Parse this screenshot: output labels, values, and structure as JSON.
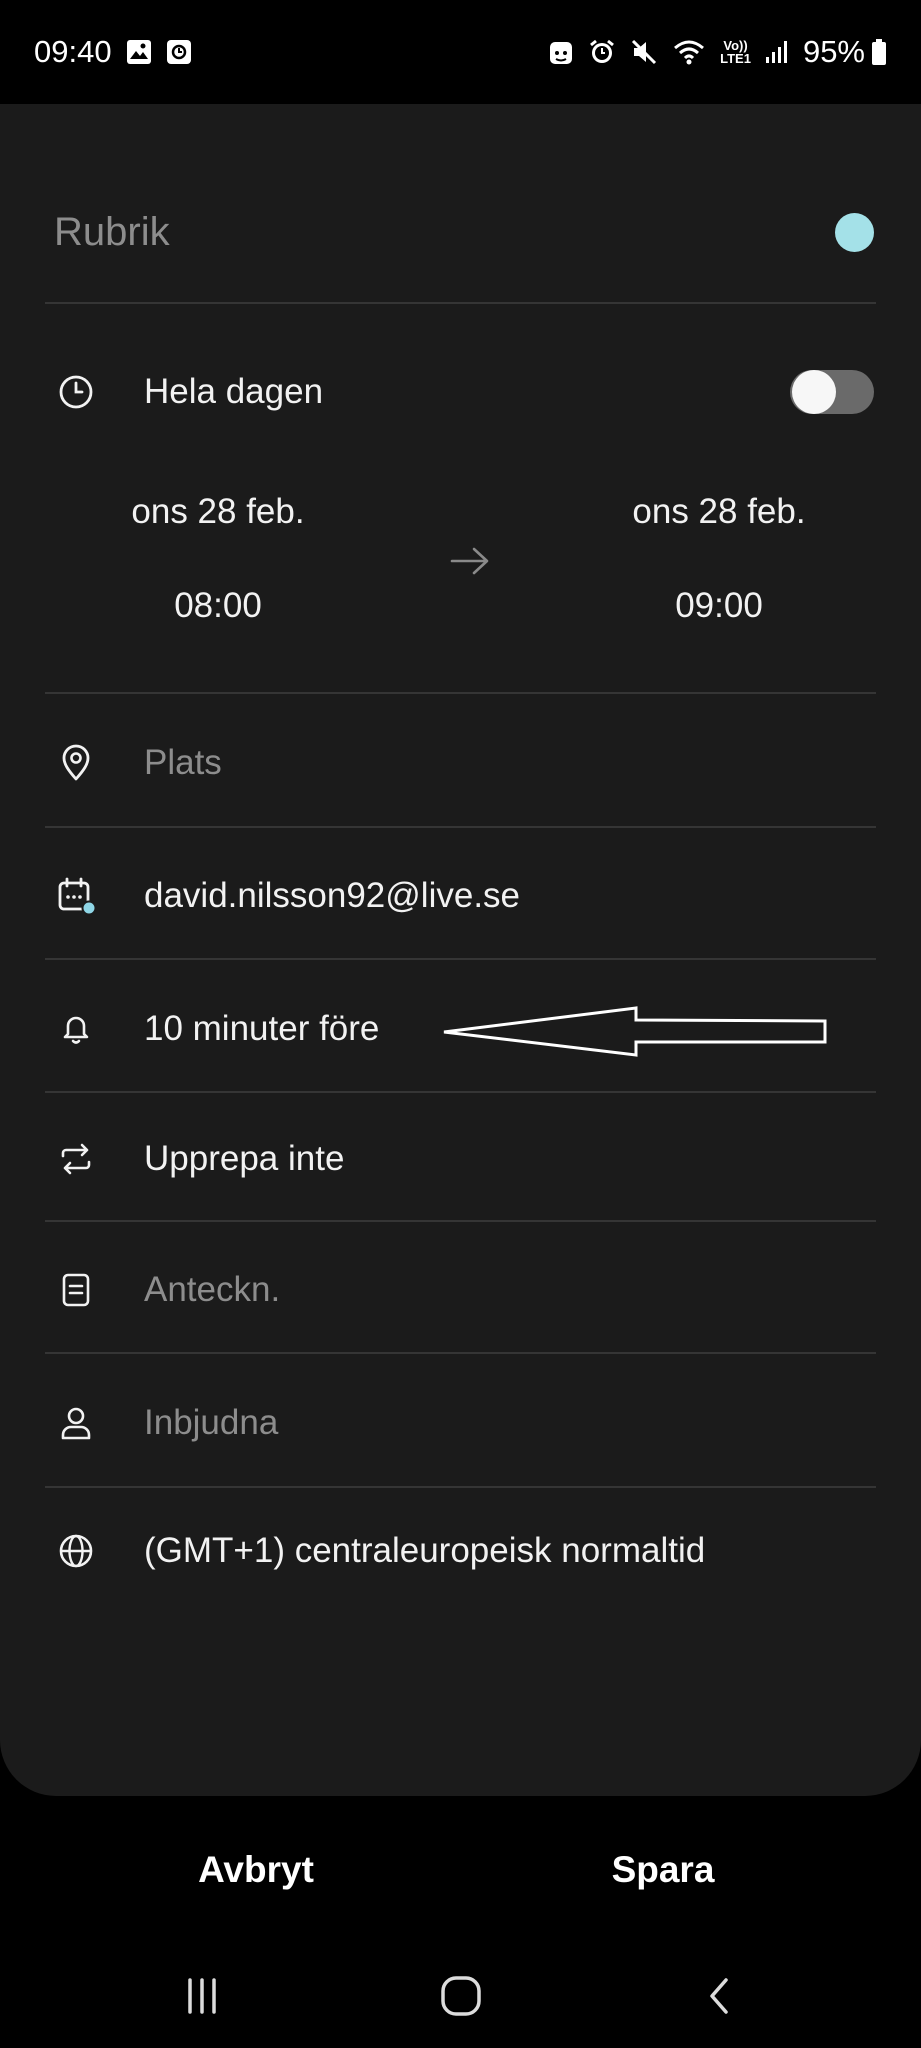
{
  "status_bar": {
    "time": "09:40",
    "battery": "95%",
    "left_icons": [
      "gallery-icon",
      "screen-recorder-icon"
    ],
    "right_icons": [
      "android-icon",
      "alarm-icon",
      "mute-icon",
      "wifi-icon",
      "volte-icon",
      "signal-icon",
      "battery-icon"
    ],
    "volte_line1": "Vo))",
    "volte_line2": "LTE1"
  },
  "event": {
    "title_placeholder": "Rubrik",
    "color_accent": "#a4e1e8",
    "all_day_label": "Hela dagen",
    "all_day_on": false,
    "start": {
      "date": "ons 28 feb.",
      "time": "08:00"
    },
    "end": {
      "date": "ons 28 feb.",
      "time": "09:00"
    },
    "location_placeholder": "Plats",
    "calendar_account": "david.nilsson92@live.se",
    "reminder": "10 minuter före",
    "repeat": "Upprepa inte",
    "notes_placeholder": "Anteckn.",
    "invitees_placeholder": "Inbjudna",
    "timezone": "(GMT+1) centraleuropeisk normaltid"
  },
  "actions": {
    "cancel": "Avbryt",
    "save": "Spara"
  },
  "icons": {
    "all_day": "clock-icon",
    "location": "location-pin-icon",
    "calendar": "calendar-icon",
    "reminder": "bell-icon",
    "repeat": "repeat-icon",
    "notes": "note-icon",
    "invitees": "person-icon",
    "timezone": "globe-icon",
    "arrow": "arrow-right-icon"
  }
}
